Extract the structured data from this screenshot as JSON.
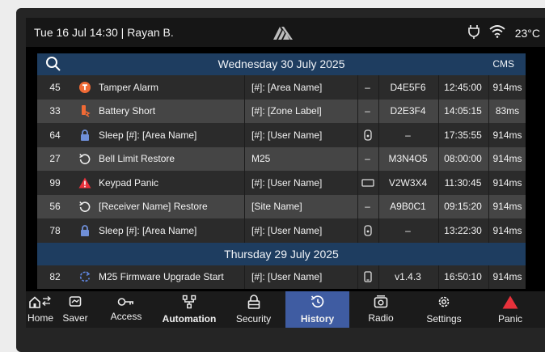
{
  "status_bar": {
    "datetime_user": "Tue 16 Jul 14:30 | Rayan B.",
    "temperature": "23°C"
  },
  "history": {
    "cms_label": "CMS",
    "day_1": "Wednesday 30 July 2025",
    "day_2": "Thursday 29 July 2025",
    "rows_day_1": [
      {
        "id": "45",
        "icon": "tamper-icon",
        "event": "Tamper Alarm",
        "user": "[#]: [Area Name]",
        "device": "dash",
        "code": "D4E5F6",
        "time": "12:45:00",
        "duration": "914ms"
      },
      {
        "id": "33",
        "icon": "battery-short-icon",
        "event": "Battery Short",
        "user": "[#]: [Zone Label]",
        "device": "dash",
        "code": "D2E3F4",
        "time": "14:05:15",
        "duration": "83ms"
      },
      {
        "id": "64",
        "icon": "lock-icon",
        "event": "Sleep [#]: [Area Name]",
        "user": "[#]: [User Name]",
        "device": "keyfob",
        "code": "–",
        "time": "17:35:55",
        "duration": "914ms"
      },
      {
        "id": "27",
        "icon": "restore-icon",
        "event": "Bell Limit Restore",
        "user": "M25",
        "device": "dash",
        "code": "M3N4O5",
        "time": "08:00:00",
        "duration": "914ms"
      },
      {
        "id": "99",
        "icon": "warning-icon",
        "event": "Keypad Panic",
        "user": "[#]: [User Name]",
        "device": "keypad",
        "code": "V2W3X4",
        "time": "11:30:45",
        "duration": "914ms"
      },
      {
        "id": "56",
        "icon": "restore-icon",
        "event": "[Receiver Name] Restore",
        "user": "[Site Name]",
        "device": "dash",
        "code": "A9B0C1",
        "time": "09:15:20",
        "duration": "914ms"
      },
      {
        "id": "78",
        "icon": "lock-icon",
        "event": "Sleep [#]: [Area Name]",
        "user": "[#]: [User Name]",
        "device": "keyfob",
        "code": "–",
        "time": "13:22:30",
        "duration": "914ms"
      }
    ],
    "rows_day_2": [
      {
        "id": "82",
        "icon": "upgrade-icon",
        "event": "M25 Firmware Upgrade Start",
        "user": "[#]: [User Name]",
        "device": "phone",
        "code": "v1.4.3",
        "time": "16:50:10",
        "duration": "914ms"
      }
    ],
    "dash": "–"
  },
  "nav": {
    "home": "Home",
    "saver": "Saver",
    "access": "Access",
    "automation": "Automation",
    "security": "Security",
    "history": "History",
    "radio": "Radio",
    "settings": "Settings",
    "panic": "Panic"
  },
  "colors": {
    "accent": "#3f5ca2",
    "day_header": "#1e3d60",
    "alarm_orange": "#f06a35",
    "lock_blue": "#6f8fd8",
    "panic_red": "#e8313b"
  }
}
